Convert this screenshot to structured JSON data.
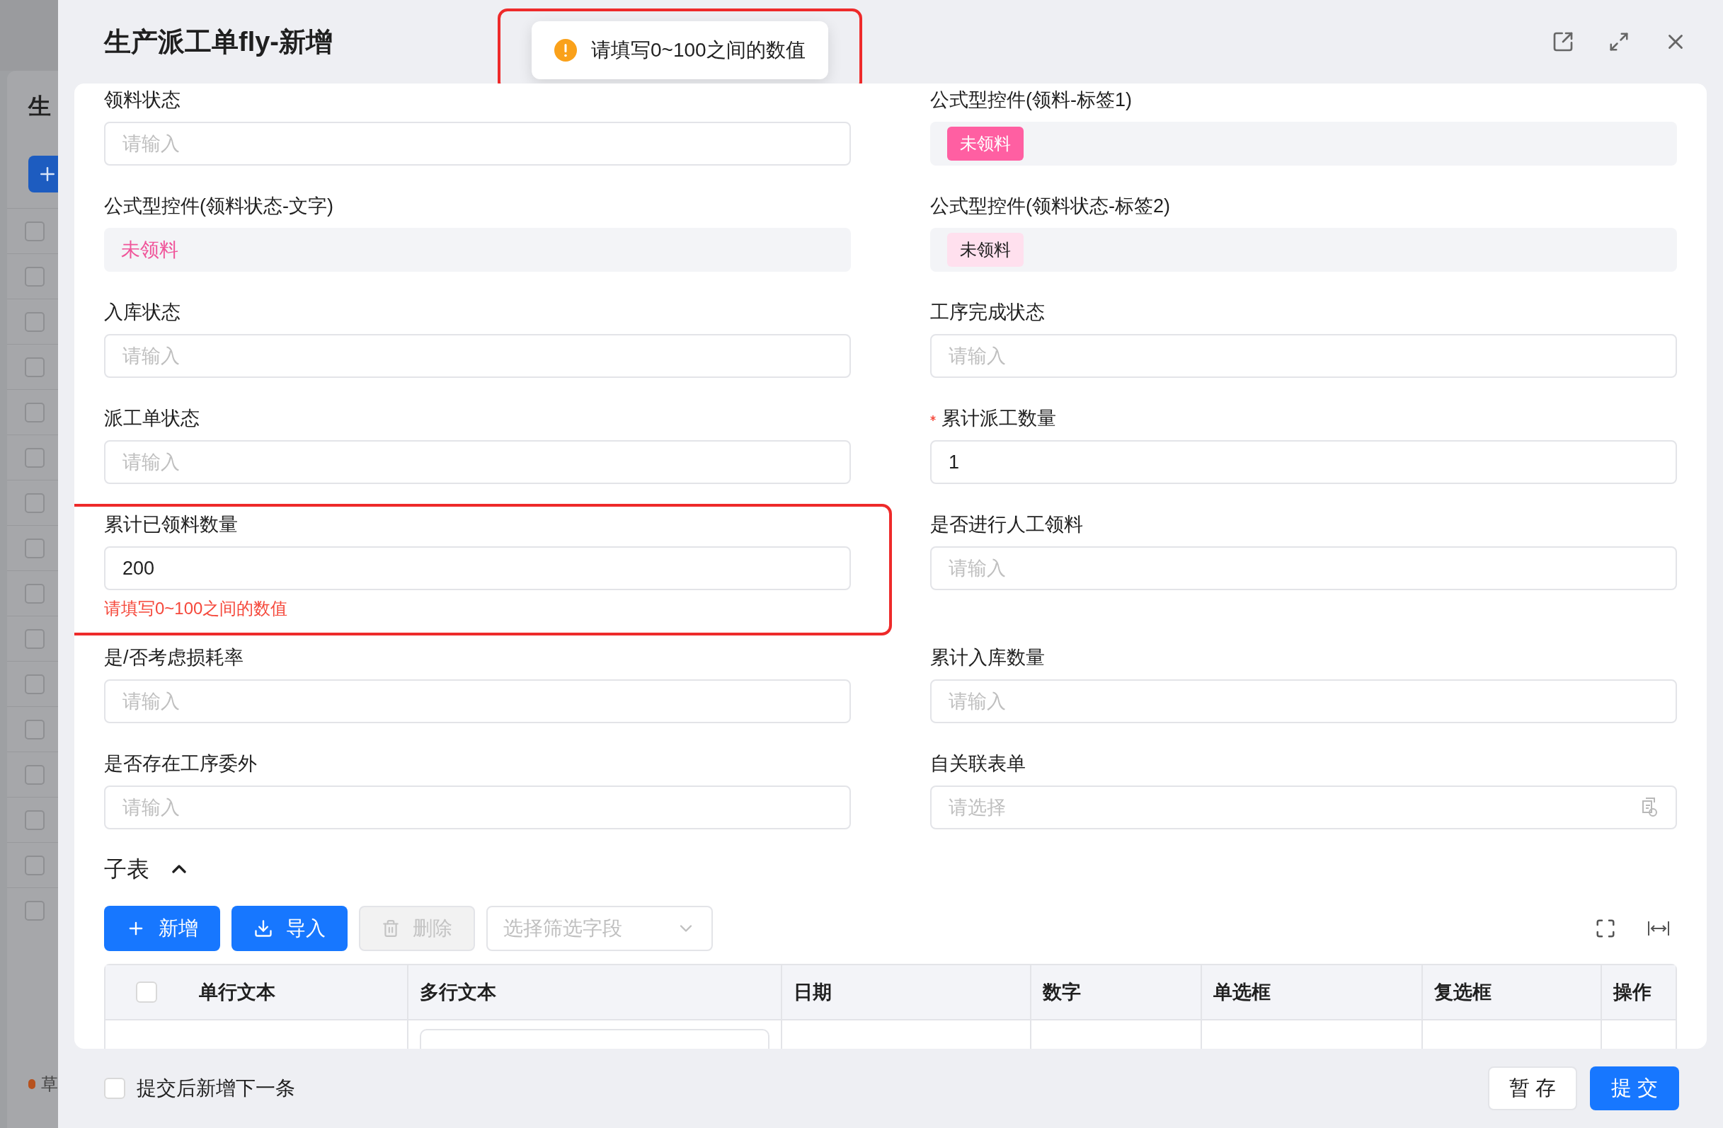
{
  "background_page": {
    "title": "生",
    "status": "草",
    "rows": [
      {
        "checked": false
      },
      {
        "checked": false
      },
      {
        "checked": false
      },
      {
        "checked": false
      },
      {
        "checked": false
      },
      {
        "checked": false
      },
      {
        "checked": false
      },
      {
        "checked": false
      },
      {
        "checked": false
      },
      {
        "checked": false
      },
      {
        "checked": false
      },
      {
        "checked": false
      },
      {
        "checked": false
      },
      {
        "checked": false
      },
      {
        "checked": false
      },
      {
        "checked": false
      }
    ]
  },
  "modal": {
    "title": "生产派工单fly-新增"
  },
  "toast": {
    "message": "请填写0~100之间的数值",
    "highlighted": true
  },
  "fields": [
    {
      "label": "领料状态",
      "kind": "input",
      "placeholder": "请输入"
    },
    {
      "label": "公式型控件(领料-标签1)",
      "kind": "tag_solid",
      "value": "未领料"
    },
    {
      "label": "公式型控件(领料状态-文字)",
      "kind": "formula_text",
      "value": "未领料"
    },
    {
      "label": "公式型控件(领料状态-标签2)",
      "kind": "tag_light",
      "value": "未领料"
    },
    {
      "label": "入库状态",
      "kind": "input",
      "placeholder": "请输入"
    },
    {
      "label": "工序完成状态",
      "kind": "input",
      "placeholder": "请输入"
    },
    {
      "label": "派工单状态",
      "kind": "input",
      "placeholder": "请输入"
    },
    {
      "label": "累计派工数量",
      "kind": "input",
      "value": "1",
      "required": true
    },
    {
      "label": "累计已领料数量",
      "kind": "input",
      "value": "200",
      "error": "请填写0~100之间的数值",
      "highlighted": true
    },
    {
      "label": "是否进行人工领料",
      "kind": "input",
      "placeholder": "请输入"
    },
    {
      "label": "是/否考虑损耗率",
      "kind": "input",
      "placeholder": "请输入"
    },
    {
      "label": "累计入库数量",
      "kind": "input",
      "placeholder": "请输入"
    },
    {
      "label": "是否存在工序委外",
      "kind": "input",
      "placeholder": "请输入"
    },
    {
      "label": "自关联表单",
      "kind": "select",
      "placeholder": "请选择"
    }
  ],
  "subtable": {
    "title": "子表",
    "expanded": true,
    "buttons": [
      {
        "label": "新增",
        "kind": "add",
        "disabled": false
      },
      {
        "label": "导入",
        "kind": "import",
        "disabled": false
      },
      {
        "label": "删除",
        "kind": "delete",
        "disabled": true
      }
    ],
    "filter": {
      "placeholder": "选择筛选字段"
    },
    "columns": [
      "单行文本",
      "多行文本",
      "日期",
      "数字",
      "单选框",
      "复选框",
      "操作"
    ],
    "select_all_checked": false
  },
  "footer": {
    "continue_label": "提交后新增下一条",
    "continue_checked": false,
    "buttons": [
      "暂 存",
      "提 交"
    ]
  }
}
